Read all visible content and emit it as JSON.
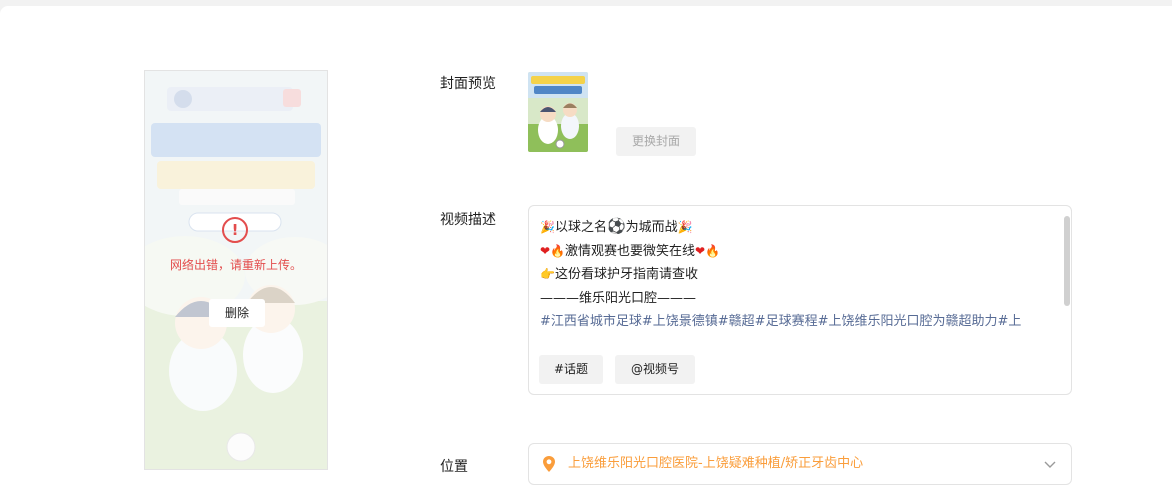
{
  "preview": {
    "error_icon": "!",
    "error_message": "网络出错，请重新上传。",
    "delete_label": "删除",
    "status_color": "#e34d4d"
  },
  "cover": {
    "label": "封面预览",
    "change_label": "更换封面"
  },
  "description": {
    "label": "视频描述",
    "lines": [
      "以球之名",
      "为城而战",
      "激情观赛也要微笑在线",
      "这份看球护牙指南请查收",
      "———维乐阳光口腔———",
      "#江西省城市足球#上饶景德镇#赣超#足球赛程#上饶维乐阳光口腔为赣超助力#上"
    ],
    "emoji": {
      "party": "🎉",
      "ball": "⚽",
      "heart": "❤",
      "fire": "🔥",
      "point": "👉"
    },
    "topic_button": "#话题",
    "channel_button": "@视频号",
    "hashtag_color": "#576b95"
  },
  "location": {
    "label": "位置",
    "value": "上饶维乐阳光口腔医院-上饶疑难种植/矫正牙齿中心",
    "color": "#fa9d3b",
    "icon": "location-pin-icon"
  }
}
